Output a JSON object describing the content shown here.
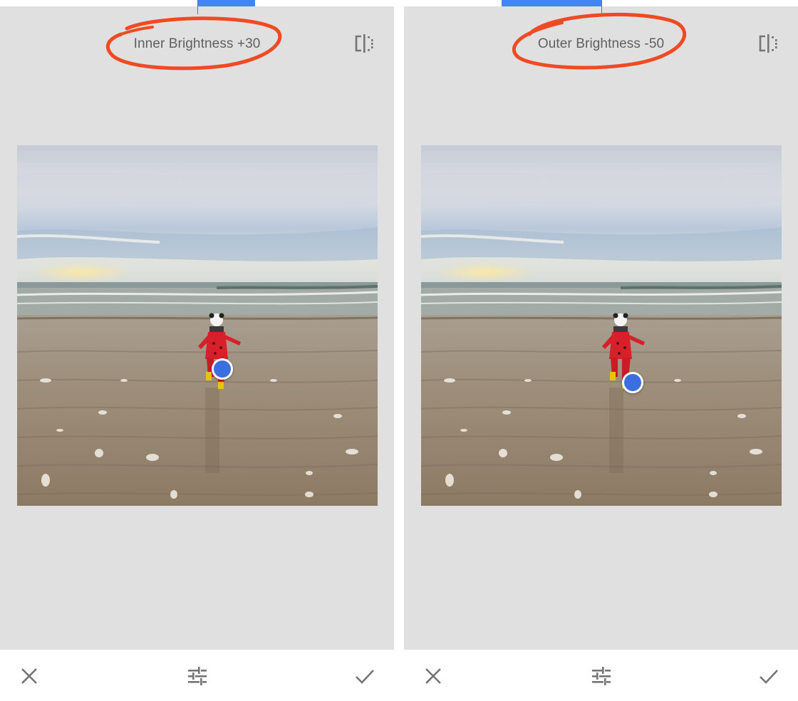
{
  "panels": [
    {
      "id": "inner",
      "parameter_label": "Inner Brightness +30",
      "toolbar": {
        "cancel_icon": "close-icon",
        "adjust_icon": "tune-sliders-icon",
        "apply_icon": "checkmark-icon"
      },
      "compare_icon": "split-compare-icon"
    },
    {
      "id": "outer",
      "parameter_label": "Outer Brightness -50",
      "toolbar": {
        "cancel_icon": "close-icon",
        "adjust_icon": "tune-sliders-icon",
        "apply_icon": "checkmark-icon"
      },
      "compare_icon": "split-compare-icon"
    }
  ],
  "colors": {
    "accent_blue": "#4285f4",
    "control_point": "#3b6fe0",
    "annotation_red": "#f04a23",
    "background_gray": "#e0e0e0",
    "label_gray": "#5f5f5f",
    "icon_gray": "#757575"
  }
}
